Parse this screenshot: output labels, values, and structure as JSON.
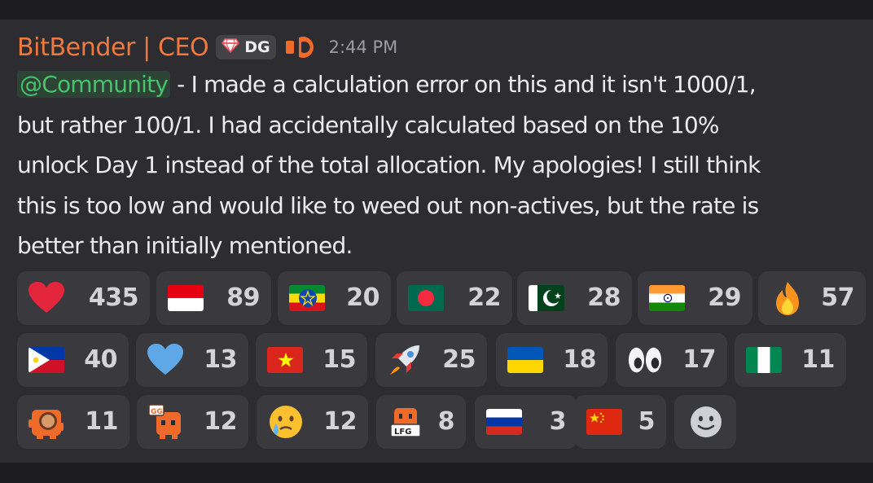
{
  "message": {
    "author": "BitBender | CEO",
    "tag": "DG",
    "timestamp": "2:44 PM",
    "mention": "@Community",
    "text_lines": [
      " - I made a calculation error on this and it isn't 1000/1,",
      "but rather 100/1. I had accidentally calculated based on the 10%",
      "unlock Day 1 instead of the total allocation. My apologies! I still think",
      "this is too low and would like to weed out non-actives, but the rate is",
      "better than initially mentioned."
    ]
  },
  "reactions": [
    {
      "icon": "red-heart-icon",
      "count": "435"
    },
    {
      "icon": "indonesia-flag-icon",
      "count": "89"
    },
    {
      "icon": "ethiopia-flag-icon",
      "count": "20"
    },
    {
      "icon": "bangladesh-flag-icon",
      "count": "22"
    },
    {
      "icon": "pakistan-flag-icon",
      "count": "28"
    },
    {
      "icon": "india-flag-icon",
      "count": "29"
    },
    {
      "icon": "fire-icon",
      "count": "57"
    },
    {
      "icon": "philippines-flag-icon",
      "count": "40"
    },
    {
      "icon": "blue-heart-icon",
      "count": "13"
    },
    {
      "icon": "vietnam-flag-icon",
      "count": "15"
    },
    {
      "icon": "rocket-icon",
      "count": "25"
    },
    {
      "icon": "ukraine-flag-icon",
      "count": "18"
    },
    {
      "icon": "eyes-icon",
      "count": "17"
    },
    {
      "icon": "nigeria-flag-icon",
      "count": "11"
    },
    {
      "icon": "orange-mascot-icon",
      "count": "11"
    },
    {
      "icon": "gg-mascot-icon",
      "count": "12"
    },
    {
      "icon": "crying-face-icon",
      "count": "12"
    },
    {
      "icon": "lfg-mascot-icon",
      "count": "8"
    },
    {
      "icon": "russia-flag-icon",
      "count": "3"
    },
    {
      "icon": "china-flag-icon",
      "count": "5"
    }
  ],
  "add_reaction_icon": "add-reaction-icon",
  "colors": {
    "author": "#f0793f",
    "mention": "#47c36b",
    "background": "#2d2c30",
    "pill": "#3a393d"
  }
}
